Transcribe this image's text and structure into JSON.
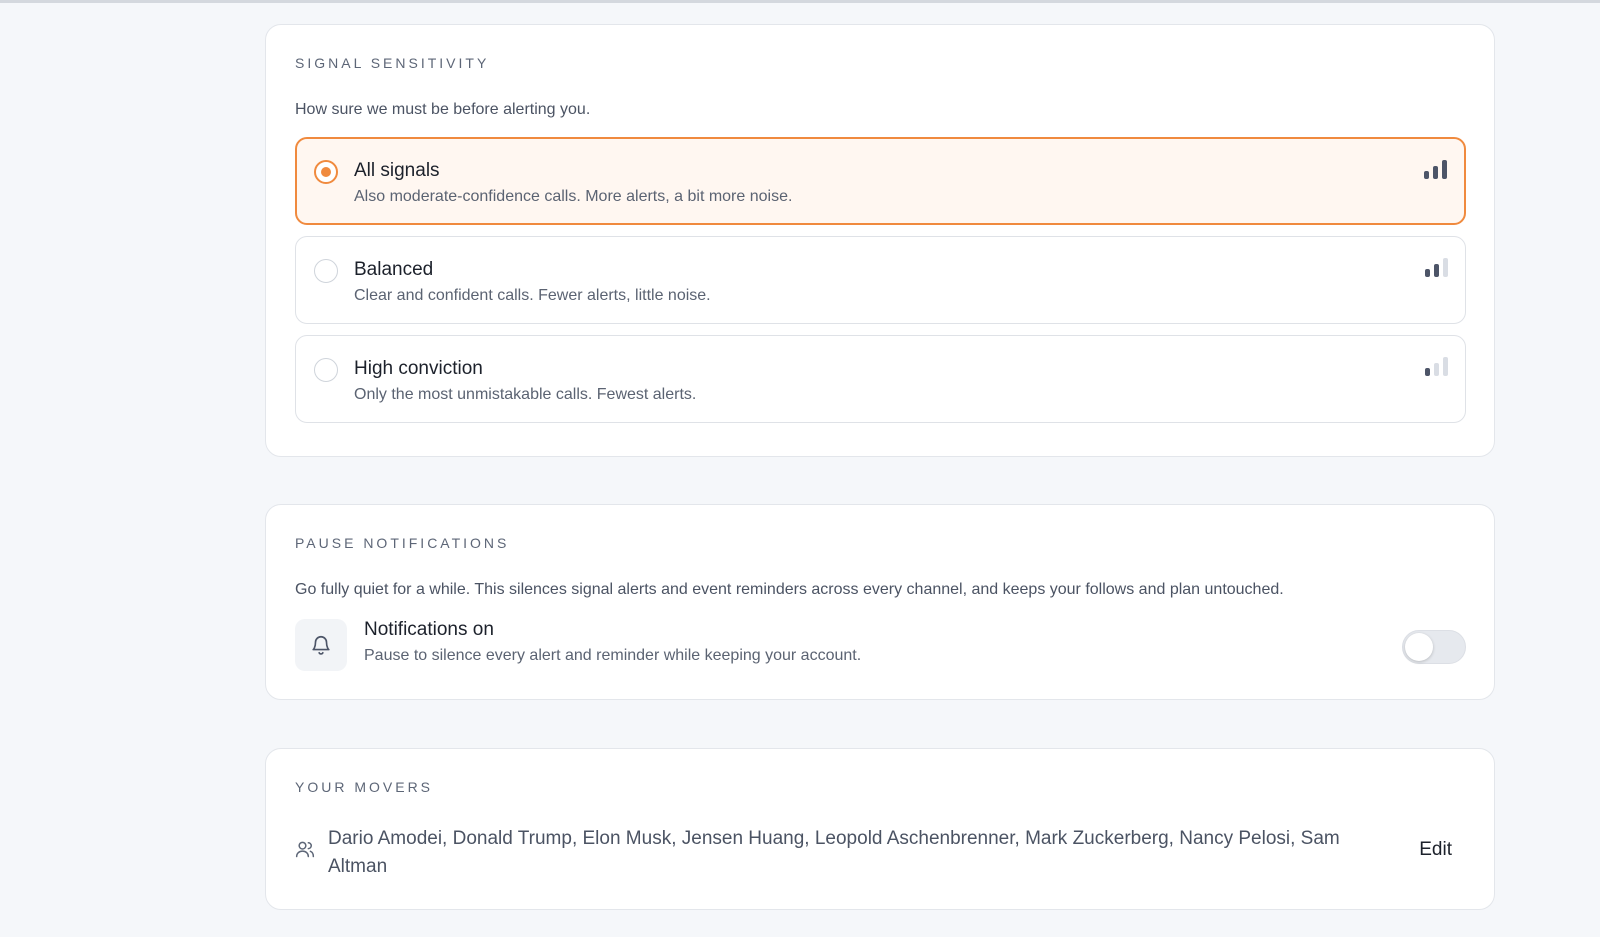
{
  "sensitivity": {
    "title": "SIGNAL SENSITIVITY",
    "description": "How sure we must be before alerting you.",
    "options": [
      {
        "label": "All signals",
        "description": "Also moderate-confidence calls. More alerts, a bit more noise.",
        "selected": true,
        "level": 3
      },
      {
        "label": "Balanced",
        "description": "Clear and confident calls. Fewer alerts, little noise.",
        "selected": false,
        "level": 2
      },
      {
        "label": "High conviction",
        "description": "Only the most unmistakable calls. Fewest alerts.",
        "selected": false,
        "level": 1
      }
    ]
  },
  "pause": {
    "title": "PAUSE NOTIFICATIONS",
    "description": "Go fully quiet for a while. This silences signal alerts and event reminders across every channel, and keeps your follows and plan untouched.",
    "status_label": "Notifications on",
    "status_description": "Pause to silence every alert and reminder while keeping your account.",
    "toggle_on": false,
    "icon": "bell-icon"
  },
  "movers": {
    "title": "YOUR MOVERS",
    "names": "Dario Amodei, Donald Trump, Elon Musk, Jensen Huang, Leopold Aschenbrenner, Mark Zuckerberg, Nancy Pelosi, Sam Altman",
    "edit_label": "Edit",
    "icon": "people-icon"
  },
  "colors": {
    "accent": "#f08a3e",
    "selected_bg": "#fff7f1",
    "bar_active": "#4d5568",
    "bar_inactive": "#d9dde4"
  }
}
